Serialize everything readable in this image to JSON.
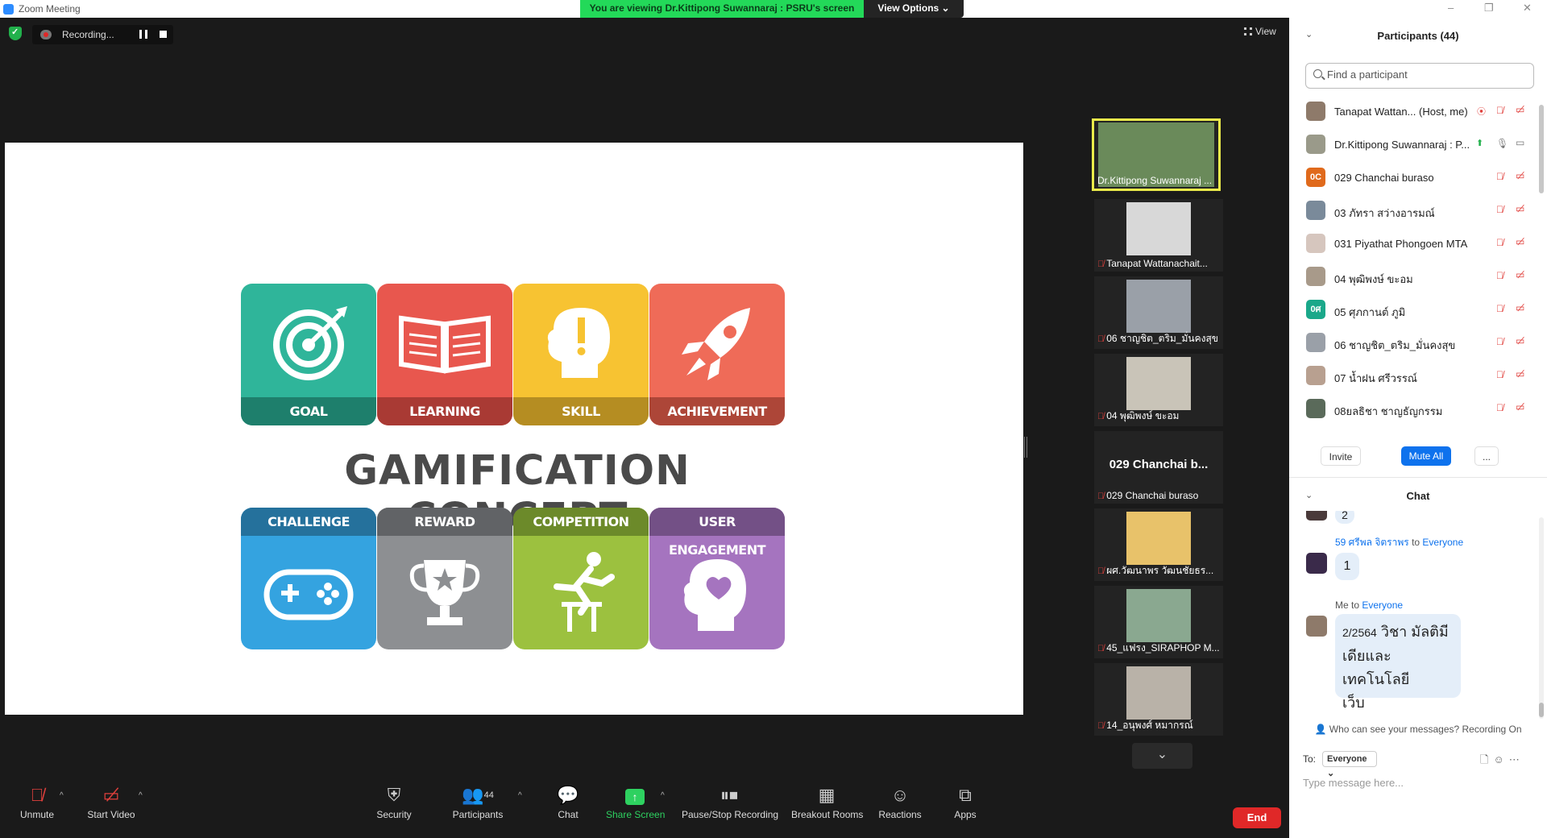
{
  "window": {
    "title": "Zoom Meeting",
    "viewing_banner": "You are viewing Dr.Kittipong Suwannaraj : PSRU's screen",
    "view_options": "View Options",
    "controls": [
      "–",
      "❐",
      "✕"
    ]
  },
  "meeting": {
    "recording_label": "Recording...",
    "view_label": "View"
  },
  "slide": {
    "headline": "GAMIFICATION CONCEPT",
    "top_tiles": [
      {
        "label": "GOAL",
        "color": "#2fb59a",
        "band": "#1e7f6c",
        "icon": "target-icon"
      },
      {
        "label": "LEARNING",
        "color": "#e8574e",
        "band": "#a93a34",
        "icon": "book-icon"
      },
      {
        "label": "SKILL",
        "color": "#f7c332",
        "band": "#b58d22",
        "icon": "head-exclaim-icon"
      },
      {
        "label": "ACHIEVEMENT",
        "color": "#ef6b58",
        "band": "#ad4638",
        "icon": "rocket-icon"
      }
    ],
    "bottom_tiles": [
      {
        "label": "CHALLENGE",
        "color": "#34a3e0",
        "band": "#25719c",
        "icon": "gamepad-icon"
      },
      {
        "label": "REWARD",
        "color": "#8d8f92",
        "band": "#616366",
        "icon": "trophy-icon"
      },
      {
        "label": "COMPETITION",
        "color": "#9cc13f",
        "band": "#6c8a2a",
        "icon": "hurdle-icon"
      },
      {
        "label": "USER ENGAGEMENT",
        "color": "#a574bf",
        "band": "#735086",
        "icon": "head-heart-icon"
      }
    ]
  },
  "filmstrip": [
    {
      "name": "Dr.Kittipong Suwannaraj ...",
      "muted": false,
      "active": true,
      "thumb": "#6a8a5a"
    },
    {
      "name": "Tanapat Wattanachait...",
      "muted": true,
      "active": false,
      "thumb": "#d8d8d8"
    },
    {
      "name": "06 ชาญชิต_ตริม_มั่นคงสุข",
      "muted": true,
      "active": false,
      "thumb": "#9aa0a8"
    },
    {
      "name": "04 พุฒิพงษ์ ขะอม",
      "muted": true,
      "active": false,
      "thumb": "#c9c4b8"
    },
    {
      "name": "029 Chanchai buraso",
      "muted": true,
      "active": false,
      "big_name": "029 Chanchai b..."
    },
    {
      "name": "ผศ.วัฒนาพร วัฒนชัยธร...",
      "muted": true,
      "active": false,
      "thumb": "#e8c26a"
    },
    {
      "name": "45_แฟรง_SIRAPHOP M...",
      "muted": true,
      "active": false,
      "thumb": "#8aa890"
    },
    {
      "name": "14_อนุพงศ์ หมากรณ์",
      "muted": true,
      "active": false,
      "thumb": "#b9b2a8"
    }
  ],
  "toolbar": {
    "unmute": "Unmute",
    "start_video": "Start Video",
    "security": "Security",
    "participants": "Participants",
    "participants_count": "44",
    "chat": "Chat",
    "share_screen": "Share Screen",
    "pause_stop": "Pause/Stop Recording",
    "breakout": "Breakout Rooms",
    "reactions": "Reactions",
    "apps": "Apps",
    "end": "End"
  },
  "participants_panel": {
    "title": "Participants (44)",
    "search_placeholder": "Find a participant",
    "participants": [
      {
        "name": "Tanapat Wattan...  (Host, me)",
        "avatar": "#8e7a6a",
        "initials": "",
        "mic": "muted",
        "video": "off"
      },
      {
        "name": "Dr.Kittipong Suwannaraj : P...",
        "avatar": "#9a9a8a",
        "initials": "",
        "mic": "on",
        "video": "on"
      },
      {
        "name": "029 Chanchai buraso",
        "avatar": "#e06a1c",
        "initials": "0C",
        "mic": "muted",
        "video": "off"
      },
      {
        "name": "03 ภัทรา สว่างอารมณ์",
        "avatar": "#7a8a9a",
        "initials": "",
        "mic": "muted",
        "video": "off"
      },
      {
        "name": "031 Piyathat Phongoen MTA",
        "avatar": "#d6c6be",
        "initials": "",
        "mic": "muted",
        "video": "off"
      },
      {
        "name": "04 พุฒิพงษ์ ขะอม",
        "avatar": "#a89a8a",
        "initials": "",
        "mic": "muted",
        "video": "off"
      },
      {
        "name": "05 ศุภกานต์ ภูมิ",
        "avatar": "#1aa88a",
        "initials": "0ศ",
        "mic": "muted",
        "video": "off"
      },
      {
        "name": "06 ชาญชิต_ตริม_มั่นคงสุข",
        "avatar": "#9aa0a8",
        "initials": "",
        "mic": "muted",
        "video": "off"
      },
      {
        "name": "07 น้ำฝน ศรีวรรณ์",
        "avatar": "#b8a090",
        "initials": "",
        "mic": "muted",
        "video": "off"
      },
      {
        "name": "08ยลธิชา ชาญธัญกรรม",
        "avatar": "#5a6a5a",
        "initials": "",
        "mic": "muted",
        "video": "off"
      }
    ],
    "invite": "Invite",
    "mute_all": "Mute All",
    "more": "..."
  },
  "chat_panel": {
    "title": "Chat",
    "prev_message": "2",
    "messages": [
      {
        "sender": "59 ศรีพล จิตราพร",
        "to_word": "to",
        "recipient": "Everyone",
        "text": "1"
      },
      {
        "sender": "Me",
        "to_word": "to",
        "recipient": "Everyone",
        "text": "2/2564 วิชา มัลติมีเดียและเทคโนโลยีเว็บ",
        "text_prefix": "2/2564",
        "text_main": "วิชา มัลติมี",
        "text_line2": "เดียและเทคโนโลยี",
        "text_line3": "เว็บ"
      }
    ],
    "who_can_see": "Who can see your messages? Recording On",
    "to_label": "To:",
    "to_value": "Everyone",
    "input_placeholder": "Type message here..."
  }
}
